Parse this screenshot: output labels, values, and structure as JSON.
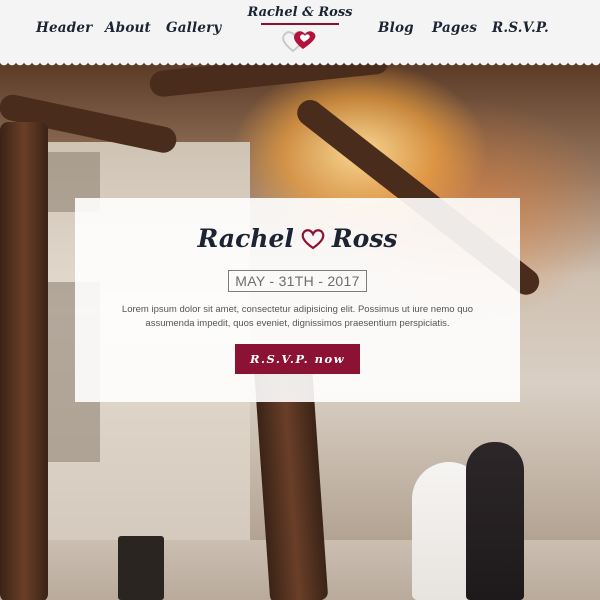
{
  "nav": {
    "left": [
      "Header",
      "About",
      "Gallery"
    ],
    "right": [
      "Blog",
      "Pages",
      "R.S.V.P."
    ]
  },
  "brand": {
    "name": "Rachel & Ross",
    "logo_icon": "double-heart-icon"
  },
  "hero": {
    "title_first": "Rachel",
    "title_second": "Ross",
    "title_icon": "heart-outline-icon",
    "date": "MAY - 31TH - 2017",
    "text": "Lorem ipsum dolor sit amet, consectetur adipisicing elit. Possimus ut iure nemo quo assumenda impedit, quos eveniet, dignissimos praesentium perspiciatis.",
    "button_label": "R.S.V.P. now"
  },
  "colors": {
    "accent": "#8c1233",
    "text_dark": "#1c2433",
    "header_bg": "#f4f4f4"
  }
}
